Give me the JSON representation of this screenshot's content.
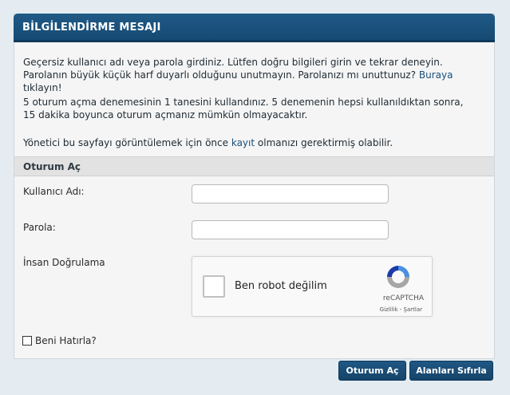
{
  "header": {
    "title": "BİLGİLENDİRME MESAJI"
  },
  "messages": {
    "error_text": "Geçersiz kullanıcı adı veya parola girdiniz. Lütfen doğru bilgileri girin ve tekrar deneyin. Parolanın büyük küçük harf duyarlı olduğunu unutmayın. Parolanızı mı unuttunuz?",
    "forgot_link": "Buraya",
    "forgot_suffix": "tıklayın!",
    "attempts_text": "5 oturum açma denemesinin 1 tanesini kullandınız. 5 denemenin hepsi kullanıldıktan sonra, 15 dakika boyunca oturum açmanız mümkün olmayacaktır.",
    "register_prefix": "Yönetici bu sayfayı görüntülemek için önce",
    "register_link": "kayıt",
    "register_suffix": "olmanızı gerektirmiş olabilir."
  },
  "login": {
    "section_title": "Oturum Aç",
    "username_label": "Kullanıcı Adı:",
    "username_value": "",
    "password_label": "Parola:",
    "password_value": "",
    "captcha_label": "İnsan Doğrulama",
    "captcha_checkbox_text": "Ben robot değilim",
    "captcha_brand": "reCAPTCHA",
    "captcha_links": "Gizlilik - Şartlar",
    "remember_label": "Beni Hatırla?",
    "remember_checked": false
  },
  "buttons": {
    "submit_label": "Oturum Aç",
    "reset_label": "Alanları Sıfırla"
  },
  "colors": {
    "header_bg": "#1a5180",
    "button_bg": "#1b4f7b",
    "link": "#17507c",
    "page_bg": "#e4ecf1"
  }
}
